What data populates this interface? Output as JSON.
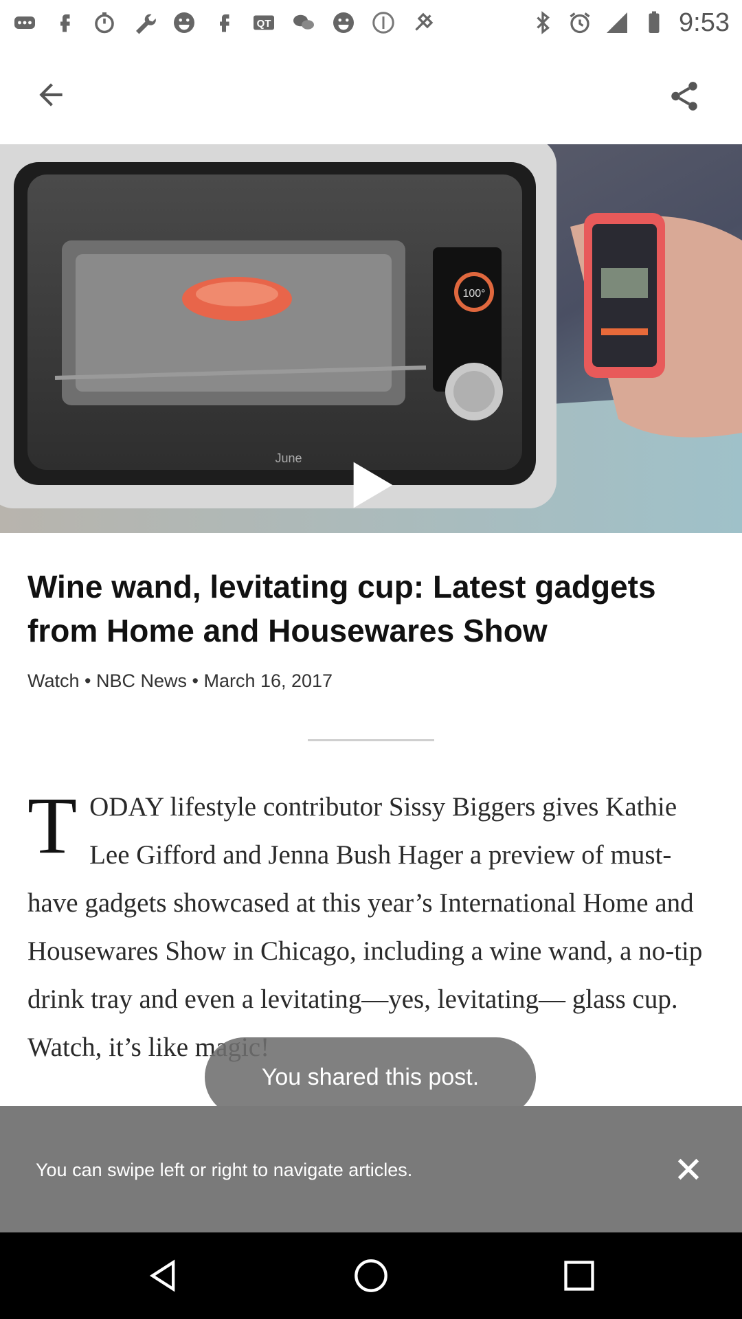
{
  "status_bar": {
    "time": "9:53",
    "left_icons": [
      "messenger-icon",
      "facebook-icon",
      "stopwatch-icon",
      "wrench-icon",
      "emoji-icon",
      "facebook-icon",
      "qt-icon",
      "wechat-icon",
      "emoji-icon",
      "info-icon",
      "fake-gps-icon"
    ],
    "right_icons": [
      "bluetooth-icon",
      "alarm-icon",
      "signal-icon",
      "battery-icon"
    ]
  },
  "app_bar": {
    "back_icon": "arrow-left-icon",
    "share_icon": "share-icon"
  },
  "video": {
    "brand_text": "June",
    "readout": "100°",
    "play_icon": "play-icon"
  },
  "article": {
    "title": "Wine wand, levitating cup: Latest gadgets from Home and Housewares Show",
    "meta": "Watch • NBC News • March 16, 2017",
    "drop_cap": "T",
    "body": "ODAY lifestyle contributor Sissy Biggers gives Kathie Lee Gifford and Jenna Bush Hager a preview of must-have gadgets showcased at this year’s International Home and Housewares Show in Chicago, including a wine wand, a no-tip drink tray and even a levitating—yes, levitating— glass cup. Watch, it’s like magic!"
  },
  "toast": {
    "message": "You shared this post."
  },
  "snackbar": {
    "message": "You can swipe left or right to navigate articles.",
    "close_icon": "close-icon"
  },
  "nav_bar": {
    "back_icon": "nav-back-icon",
    "home_icon": "nav-home-icon",
    "recents_icon": "nav-recents-icon"
  },
  "colors": {
    "snackbar_bg": "#7a7a7a",
    "toast_bg": "#6e6e6e",
    "nav_bg": "#000000",
    "icon_gray": "#666666"
  }
}
